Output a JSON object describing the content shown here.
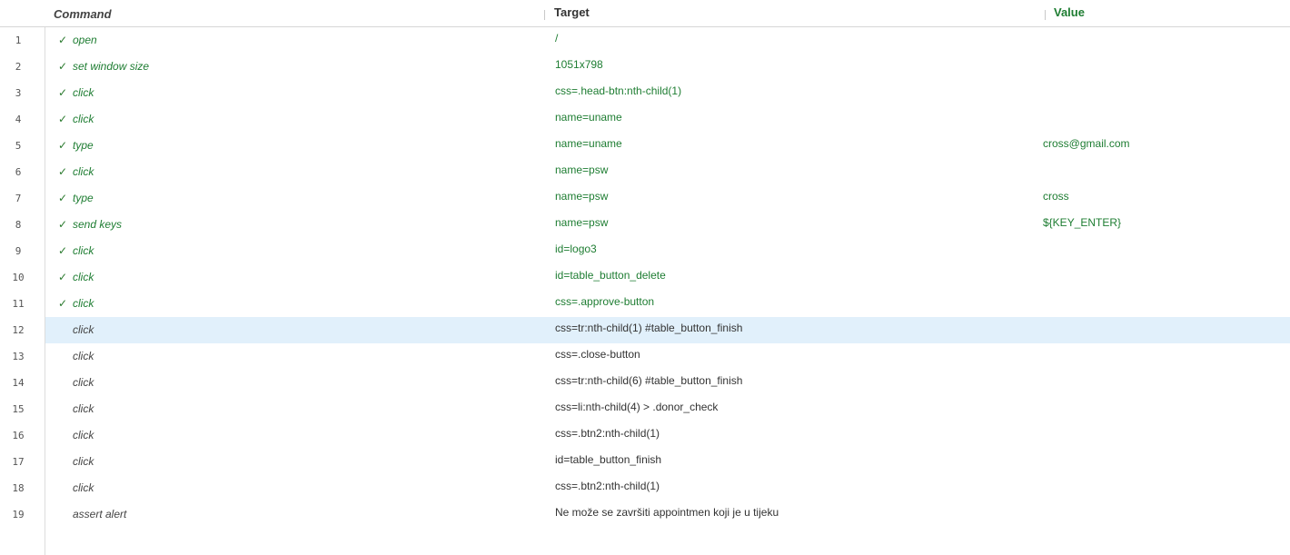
{
  "header": {
    "command": "Command",
    "target": "Target",
    "value": "Value"
  },
  "colors": {
    "success_text": "#1e7d32",
    "selected_row_bg": "#e1f0fb",
    "default_text": "#333333"
  },
  "rows": [
    {
      "num": "1",
      "command": "open",
      "target": "/",
      "value": "",
      "status": "passed"
    },
    {
      "num": "2",
      "command": "set window size",
      "target": "1051x798",
      "value": "",
      "status": "passed"
    },
    {
      "num": "3",
      "command": "click",
      "target": "css=.head-btn:nth-child(1)",
      "value": "",
      "status": "passed"
    },
    {
      "num": "4",
      "command": "click",
      "target": "name=uname",
      "value": "",
      "status": "passed"
    },
    {
      "num": "5",
      "command": "type",
      "target": "name=uname",
      "value": "cross@gmail.com",
      "status": "passed"
    },
    {
      "num": "6",
      "command": "click",
      "target": "name=psw",
      "value": "",
      "status": "passed"
    },
    {
      "num": "7",
      "command": "type",
      "target": "name=psw",
      "value": "cross",
      "status": "passed"
    },
    {
      "num": "8",
      "command": "send keys",
      "target": "name=psw",
      "value": "${KEY_ENTER}",
      "status": "passed"
    },
    {
      "num": "9",
      "command": "click",
      "target": "id=logo3",
      "value": "",
      "status": "passed"
    },
    {
      "num": "10",
      "command": "click",
      "target": "id=table_button_delete",
      "value": "",
      "status": "passed"
    },
    {
      "num": "11",
      "command": "click",
      "target": "css=.approve-button",
      "value": "",
      "status": "passed"
    },
    {
      "num": "12",
      "command": "click",
      "target": "css=tr:nth-child(1) #table_button_finish",
      "value": "",
      "status": "selected"
    },
    {
      "num": "13",
      "command": "click",
      "target": "css=.close-button",
      "value": "",
      "status": "pending"
    },
    {
      "num": "14",
      "command": "click",
      "target": "css=tr:nth-child(6) #table_button_finish",
      "value": "",
      "status": "pending"
    },
    {
      "num": "15",
      "command": "click",
      "target": "css=li:nth-child(4) > .donor_check",
      "value": "",
      "status": "pending"
    },
    {
      "num": "16",
      "command": "click",
      "target": "css=.btn2:nth-child(1)",
      "value": "",
      "status": "pending"
    },
    {
      "num": "17",
      "command": "click",
      "target": "id=table_button_finish",
      "value": "",
      "status": "pending"
    },
    {
      "num": "18",
      "command": "click",
      "target": "css=.btn2:nth-child(1)",
      "value": "",
      "status": "pending"
    },
    {
      "num": "19",
      "command": "assert alert",
      "target": "Ne može se završiti appointmen koji je u tijeku",
      "value": "",
      "status": "pending"
    }
  ]
}
